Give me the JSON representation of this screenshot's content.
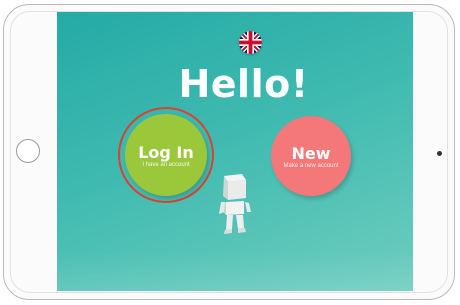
{
  "screen": {
    "title": "Hello!",
    "language": "English (UK flag)"
  },
  "buttons": {
    "login": {
      "label": "Log In",
      "subtitle": "I have an account"
    },
    "new": {
      "label": "New",
      "subtitle": "Make a new account"
    }
  },
  "colors": {
    "background_top": "#25aaa6",
    "background_bottom": "#6fcdbf",
    "login_green": "#9bc83a",
    "new_coral": "#f47779",
    "highlight_ring": "#d9432f"
  }
}
